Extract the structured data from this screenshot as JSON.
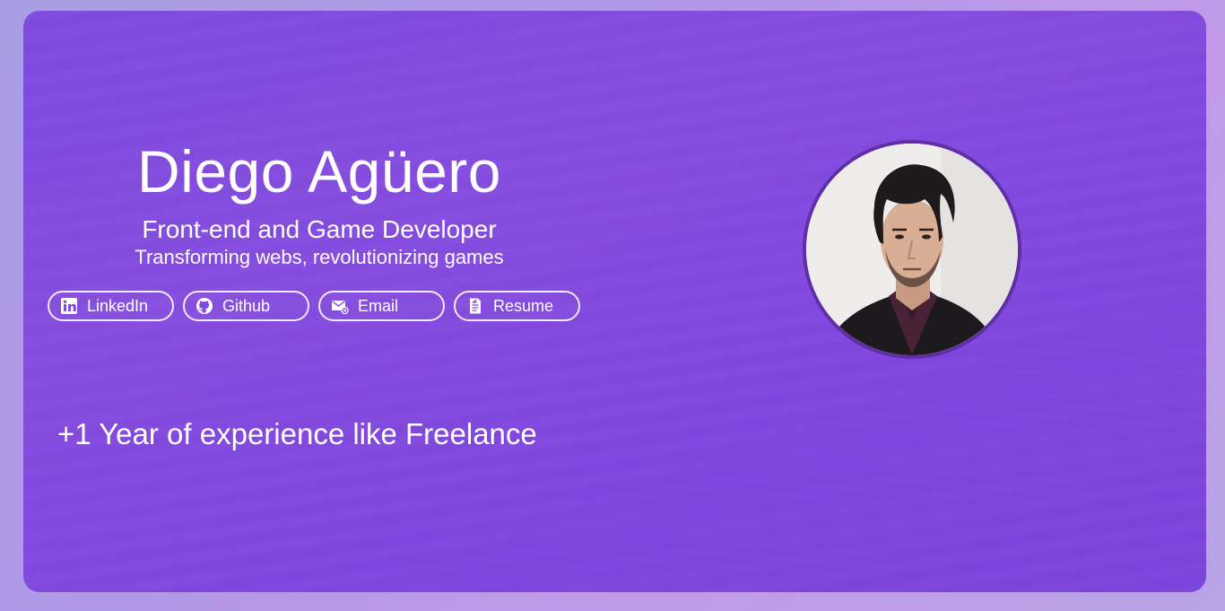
{
  "profile": {
    "name": "Diego Agüero",
    "role": "Front-end and Game Developer",
    "tagline": "Transforming webs, revolutionizing games",
    "experience": "+1 Year of experience like Freelance"
  },
  "links": [
    {
      "label": "LinkedIn",
      "icon": "linkedin-icon"
    },
    {
      "label": "Github",
      "icon": "github-icon"
    },
    {
      "label": "Email",
      "icon": "email-icon"
    },
    {
      "label": "Resume",
      "icon": "resume-icon"
    }
  ],
  "colors": {
    "card_background": "#8049df",
    "page_background": "#b39de6",
    "text": "#ffffff",
    "button_border": "#f1eafc",
    "avatar_border": "#5f2fa8"
  }
}
